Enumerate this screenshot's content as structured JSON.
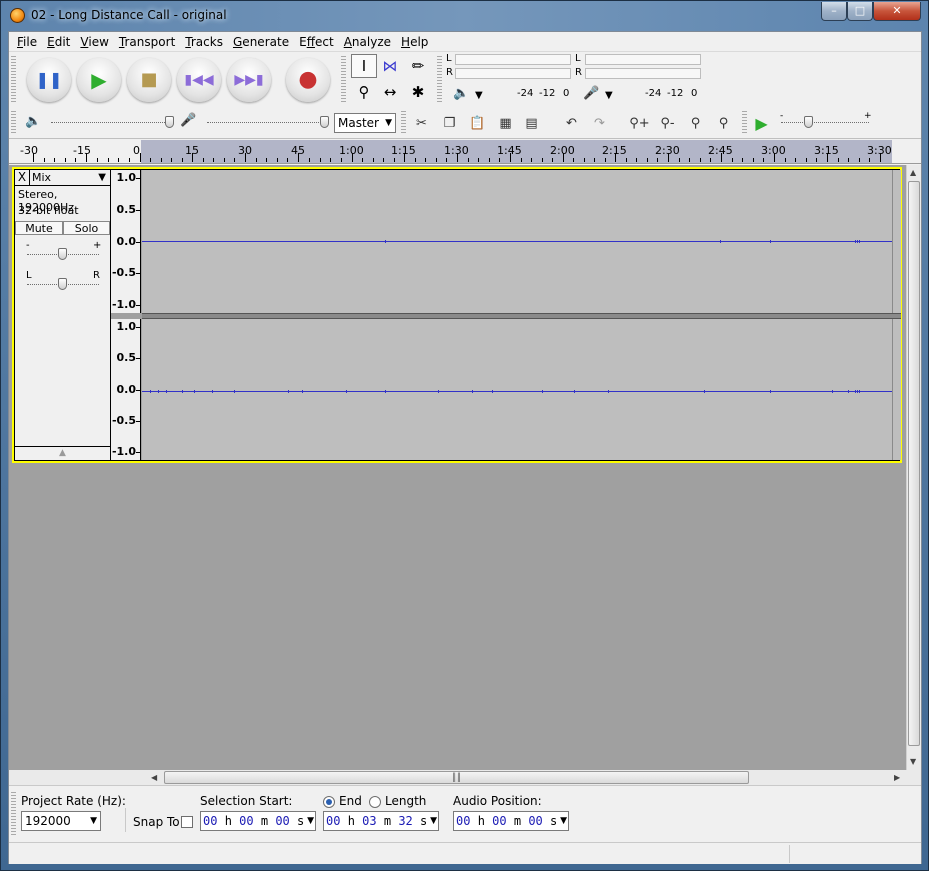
{
  "window": {
    "title": "02 - Long Distance Call - original",
    "min": "0",
    "max": "1",
    "close": "r"
  },
  "menu": [
    {
      "label": "File",
      "key": "F",
      "rest": "ile"
    },
    {
      "label": "Edit",
      "key": "E",
      "rest": "dit"
    },
    {
      "label": "View",
      "key": "V",
      "rest": "iew"
    },
    {
      "label": "Transport",
      "key": "T",
      "rest": "ransport"
    },
    {
      "label": "Tracks",
      "key": "T",
      "rest": "racks"
    },
    {
      "label": "Generate",
      "key": "G",
      "rest": "enerate"
    },
    {
      "label": "Effect",
      "key": "ffect",
      "pre": "E"
    },
    {
      "label": "Analyze",
      "key": "A",
      "rest": "nalyze"
    },
    {
      "label": "Help",
      "key": "H",
      "rest": "elp"
    }
  ],
  "meters": {
    "play_L": "L",
    "play_R": "R",
    "rec_L": "L",
    "rec_R": "R",
    "play_scale": [
      "-24",
      "-12",
      "0"
    ],
    "rec_scale": [
      "-24",
      "-12",
      "0"
    ]
  },
  "mixer": {
    "input_source": "Master"
  },
  "ruler": {
    "ticks": [
      "-30",
      "-15",
      "0",
      "15",
      "30",
      "45",
      "1:00",
      "1:15",
      "1:30",
      "1:45",
      "2:00",
      "2:15",
      "2:30",
      "2:45",
      "3:00",
      "3:15",
      "3:30"
    ]
  },
  "track": {
    "close": "X",
    "name": "Mix",
    "format": "Stereo, 192000Hz",
    "bit_depth": "32-bit float",
    "mute": "Mute",
    "solo": "Solo",
    "gain_minus": "-",
    "gain_plus": "+",
    "pan_left": "L",
    "pan_right": "R",
    "scale": [
      "1.0",
      "0.5",
      "0.0",
      "-0.5",
      "-1.0"
    ]
  },
  "selection_bar": {
    "project_rate_label": "Project Rate (Hz):",
    "project_rate_value": "192000",
    "snap_to_label": "Snap To",
    "selection_start_label": "Selection Start:",
    "end_label": "End",
    "length_label": "Length",
    "audio_position_label": "Audio Position:",
    "selection_start": {
      "h": "00",
      "m": "00",
      "s": "00"
    },
    "selection_end": {
      "h": "00",
      "m": "03",
      "s": "32"
    },
    "audio_position": {
      "h": "00",
      "m": "00",
      "s": "00"
    },
    "unit_h": "h",
    "unit_m": "m",
    "unit_s": "s"
  },
  "colors": {
    "waveform": "#3232c8",
    "track_focus": "#ffff00",
    "wave_bg": "#bebebe",
    "ruler_selection": "#b2b5c8"
  }
}
